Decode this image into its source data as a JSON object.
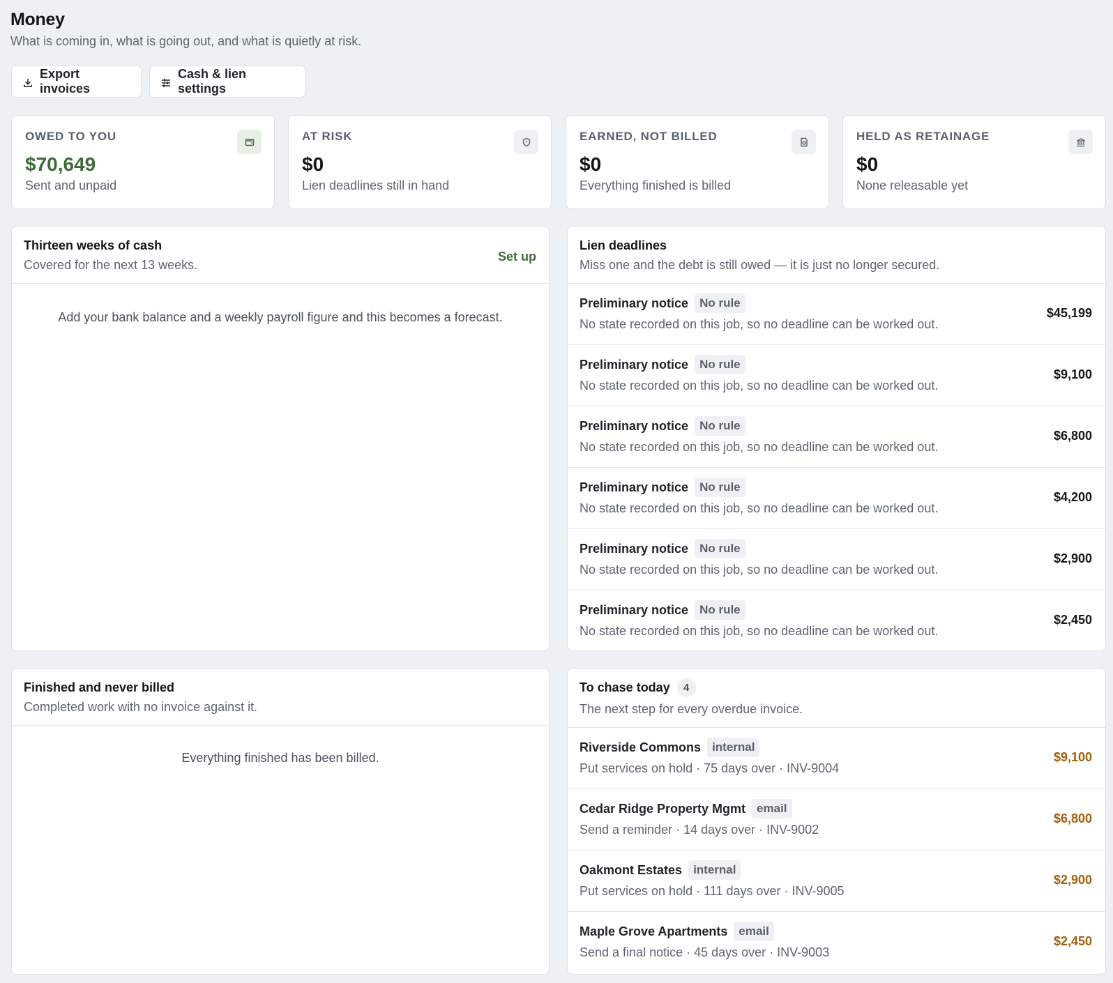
{
  "header": {
    "title": "Money",
    "subtitle": "What is coming in, what is going out, and what is quietly at risk."
  },
  "actions": {
    "export_label": "Export invoices",
    "settings_label": "Cash & lien settings"
  },
  "stats": [
    {
      "label": "OWED TO YOU",
      "value": "$70,649",
      "note": "Sent and unpaid",
      "icon": "wallet-icon",
      "accent": "#3f6b3a"
    },
    {
      "label": "AT RISK",
      "value": "$0",
      "note": "Lien deadlines still in hand",
      "icon": "shield-icon"
    },
    {
      "label": "EARNED, NOT BILLED",
      "value": "$0",
      "note": "Everything finished is billed",
      "icon": "receipt-icon"
    },
    {
      "label": "HELD AS RETAINAGE",
      "value": "$0",
      "note": "None releasable yet",
      "icon": "bank-icon"
    }
  ],
  "cash": {
    "title": "Thirteen weeks of cash",
    "subtitle": "Covered for the next 13 weeks.",
    "setup_label": "Set up",
    "empty": "Add your bank balance and a weekly payroll figure and this becomes a forecast."
  },
  "liens": {
    "title": "Lien deadlines",
    "subtitle": "Miss one and the debt is still owed — it is just no longer secured.",
    "rows": [
      {
        "name": "Preliminary notice",
        "tag": "No rule",
        "desc": "No state recorded on this job, so no deadline can be worked out.",
        "amount": "$45,199"
      },
      {
        "name": "Preliminary notice",
        "tag": "No rule",
        "desc": "No state recorded on this job, so no deadline can be worked out.",
        "amount": "$9,100"
      },
      {
        "name": "Preliminary notice",
        "tag": "No rule",
        "desc": "No state recorded on this job, so no deadline can be worked out.",
        "amount": "$6,800"
      },
      {
        "name": "Preliminary notice",
        "tag": "No rule",
        "desc": "No state recorded on this job, so no deadline can be worked out.",
        "amount": "$4,200"
      },
      {
        "name": "Preliminary notice",
        "tag": "No rule",
        "desc": "No state recorded on this job, so no deadline can be worked out.",
        "amount": "$2,900"
      },
      {
        "name": "Preliminary notice",
        "tag": "No rule",
        "desc": "No state recorded on this job, so no deadline can be worked out.",
        "amount": "$2,450"
      }
    ]
  },
  "unbilled": {
    "title": "Finished and never billed",
    "subtitle": "Completed work with no invoice against it.",
    "empty": "Everything finished has been billed."
  },
  "chase": {
    "title": "To chase today",
    "count": "4",
    "subtitle": "The next step for every overdue invoice.",
    "amount_color": "#a3600c",
    "rows": [
      {
        "name": "Riverside Commons",
        "tag": "internal",
        "desc": "Put services on hold · 75 days over · INV-9004",
        "amount": "$9,100"
      },
      {
        "name": "Cedar Ridge Property Mgmt",
        "tag": "email",
        "desc": "Send a reminder · 14 days over · INV-9002",
        "amount": "$6,800"
      },
      {
        "name": "Oakmont Estates",
        "tag": "internal",
        "desc": "Put services on hold · 111 days over · INV-9005",
        "amount": "$2,900"
      },
      {
        "name": "Maple Grove Apartments",
        "tag": "email",
        "desc": "Send a final notice · 45 days over · INV-9003",
        "amount": "$2,450"
      }
    ]
  }
}
